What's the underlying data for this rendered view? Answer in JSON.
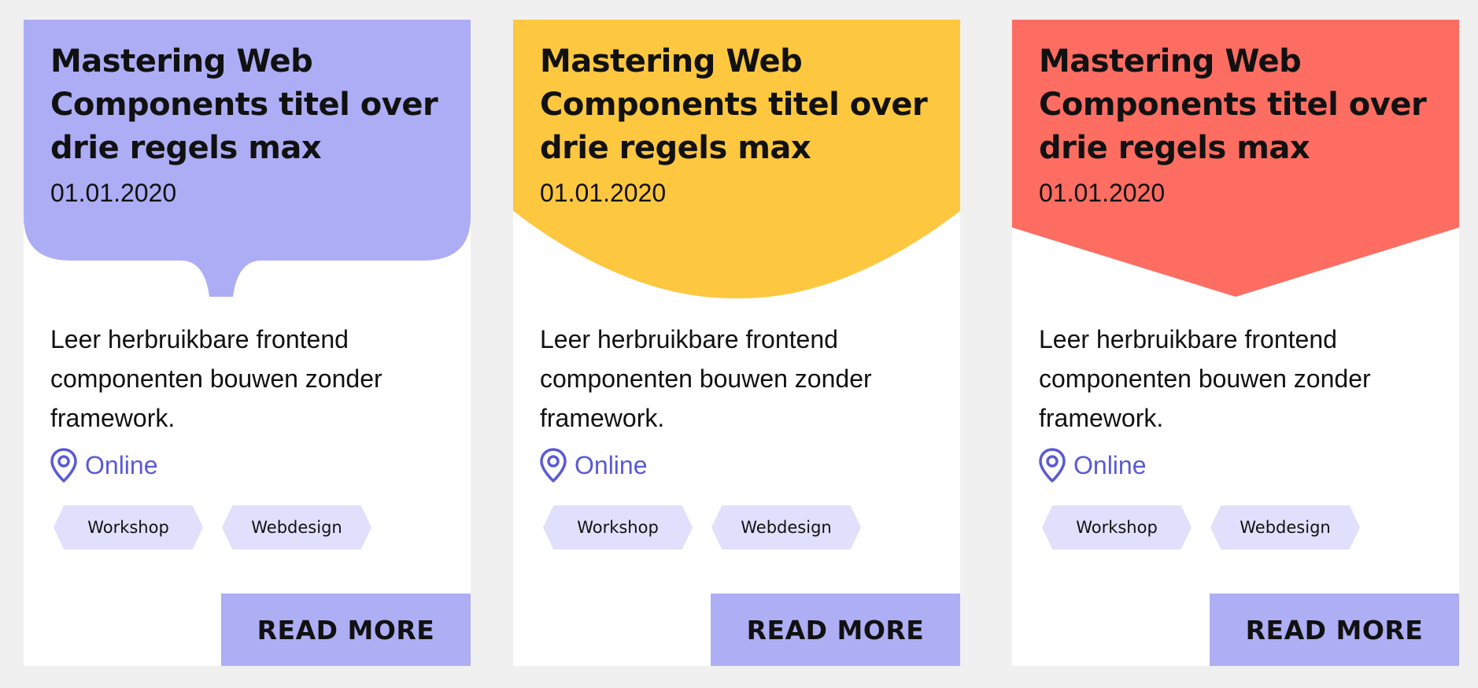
{
  "colors": {
    "background": "#f0f0f0",
    "card": "#ffffff",
    "header_purple": "#adadf5",
    "header_yellow": "#fdc740",
    "header_red": "#fd6d62",
    "accent": "#5a5ad6",
    "tag_bg": "#e0e0fc",
    "button_bg": "#aeaef5"
  },
  "cards": [
    {
      "header_style": "speech-bubble",
      "title": "Mastering Web Components titel over drie regels max",
      "date": "01.01.2020",
      "description": "Leer herbruikbare frontend componenten bouwen zonder framework.",
      "location": {
        "icon": "map-pin-icon",
        "label": "Online"
      },
      "tags": [
        "Workshop",
        "Webdesign"
      ],
      "cta": "READ MORE"
    },
    {
      "header_style": "curved",
      "title": "Mastering Web Components titel over drie regels max",
      "date": "01.01.2020",
      "description": "Leer herbruikbare frontend componenten bouwen zonder framework.",
      "location": {
        "icon": "map-pin-icon",
        "label": "Online"
      },
      "tags": [
        "Workshop",
        "Webdesign"
      ],
      "cta": "READ MORE"
    },
    {
      "header_style": "arrow",
      "title": "Mastering Web Components titel over drie regels max",
      "date": "01.01.2020",
      "description": "Leer herbruikbare frontend componenten bouwen zonder framework.",
      "location": {
        "icon": "map-pin-icon",
        "label": "Online"
      },
      "tags": [
        "Workshop",
        "Webdesign"
      ],
      "cta": "READ MORE"
    }
  ]
}
